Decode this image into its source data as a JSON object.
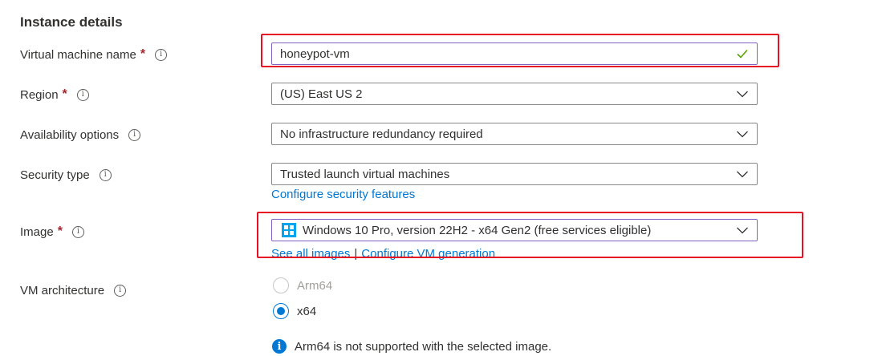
{
  "section": {
    "title": "Instance details"
  },
  "fields": {
    "vm_name": {
      "label": "Virtual machine name",
      "required_mark": "*",
      "value": "honeypot-vm"
    },
    "region": {
      "label": "Region",
      "required_mark": "*",
      "value": "(US) East US 2"
    },
    "availability": {
      "label": "Availability options",
      "value": "No infrastructure redundancy required"
    },
    "security_type": {
      "label": "Security type",
      "value": "Trusted launch virtual machines",
      "link": "Configure security features"
    },
    "image": {
      "label": "Image",
      "required_mark": "*",
      "value": "Windows 10 Pro, version 22H2 - x64 Gen2 (free services eligible)",
      "link_all": "See all images",
      "separator": "|",
      "link_config": "Configure VM generation"
    },
    "vm_arch": {
      "label": "VM architecture",
      "options": [
        "Arm64",
        "x64"
      ],
      "selected": "x64"
    }
  },
  "note": {
    "text": "Arm64 is not supported with the selected image."
  },
  "colors": {
    "accent": "#0078d4",
    "highlight_box": "#e81123",
    "valid_check": "#57a300"
  },
  "icons": [
    "info-icon",
    "checkmark-icon",
    "chevron-down-icon",
    "windows-logo-icon",
    "info-filled-icon"
  ]
}
